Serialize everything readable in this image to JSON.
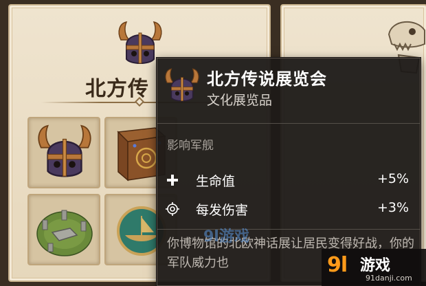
{
  "exhibit": {
    "title_visible": "北方传",
    "exhibit_icon": "viking-helmet-icon",
    "slots": [
      {
        "icon": "viking-helmet-icon"
      },
      {
        "icon": "ornate-book-icon"
      },
      {
        "icon": "stone-circle-icon"
      },
      {
        "icon": "viking-ship-icon"
      }
    ]
  },
  "right_panel": {
    "icon": "dinosaur-skull-icon"
  },
  "tooltip": {
    "icon": "viking-helmet-icon",
    "title": "北方传说展览会",
    "subtitle": "文化展览品",
    "section_label": "影响军舰",
    "stats": [
      {
        "icon": "plus-icon",
        "label": "生命值",
        "value": "+5%"
      },
      {
        "icon": "crosshair-icon",
        "label": "每发伤害",
        "value": "+3%"
      }
    ],
    "description": "你博物馆的北欧神话展让居民变得好战，你的军队威力也"
  },
  "watermark": {
    "logo": "9l",
    "name": "游戏",
    "url": "91danji.com",
    "ghost_text": "9l游戏"
  },
  "colors": {
    "parchment": "#efe4cf",
    "tooltip_bg": "#1e1a18",
    "title_text": "#3a2a1a",
    "watermark_orange": "#ff9a1a"
  }
}
